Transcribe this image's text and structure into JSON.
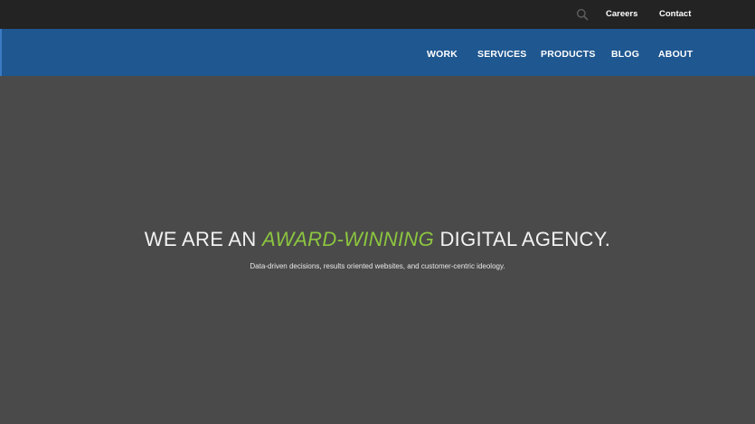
{
  "topbar": {
    "search_icon": "search-icon",
    "links": {
      "careers": "Careers",
      "contact": "Contact"
    }
  },
  "nav": {
    "items": [
      "WORK",
      "SERVICES",
      "PRODUCTS",
      "BLOG",
      "ABOUT"
    ]
  },
  "hero": {
    "headline_before": "WE ARE AN",
    "headline_accent": "AWARD-WINNING",
    "headline_after": "DIGITAL AGENCY.",
    "subline": "Data-driven decisions, results oriented websites, and customer-centric ideology."
  },
  "colors": {
    "topbar_bg": "#232323",
    "nav_bg": "#1f5790",
    "hero_bg": "#4a4a4a",
    "accent": "#8cc63f"
  }
}
